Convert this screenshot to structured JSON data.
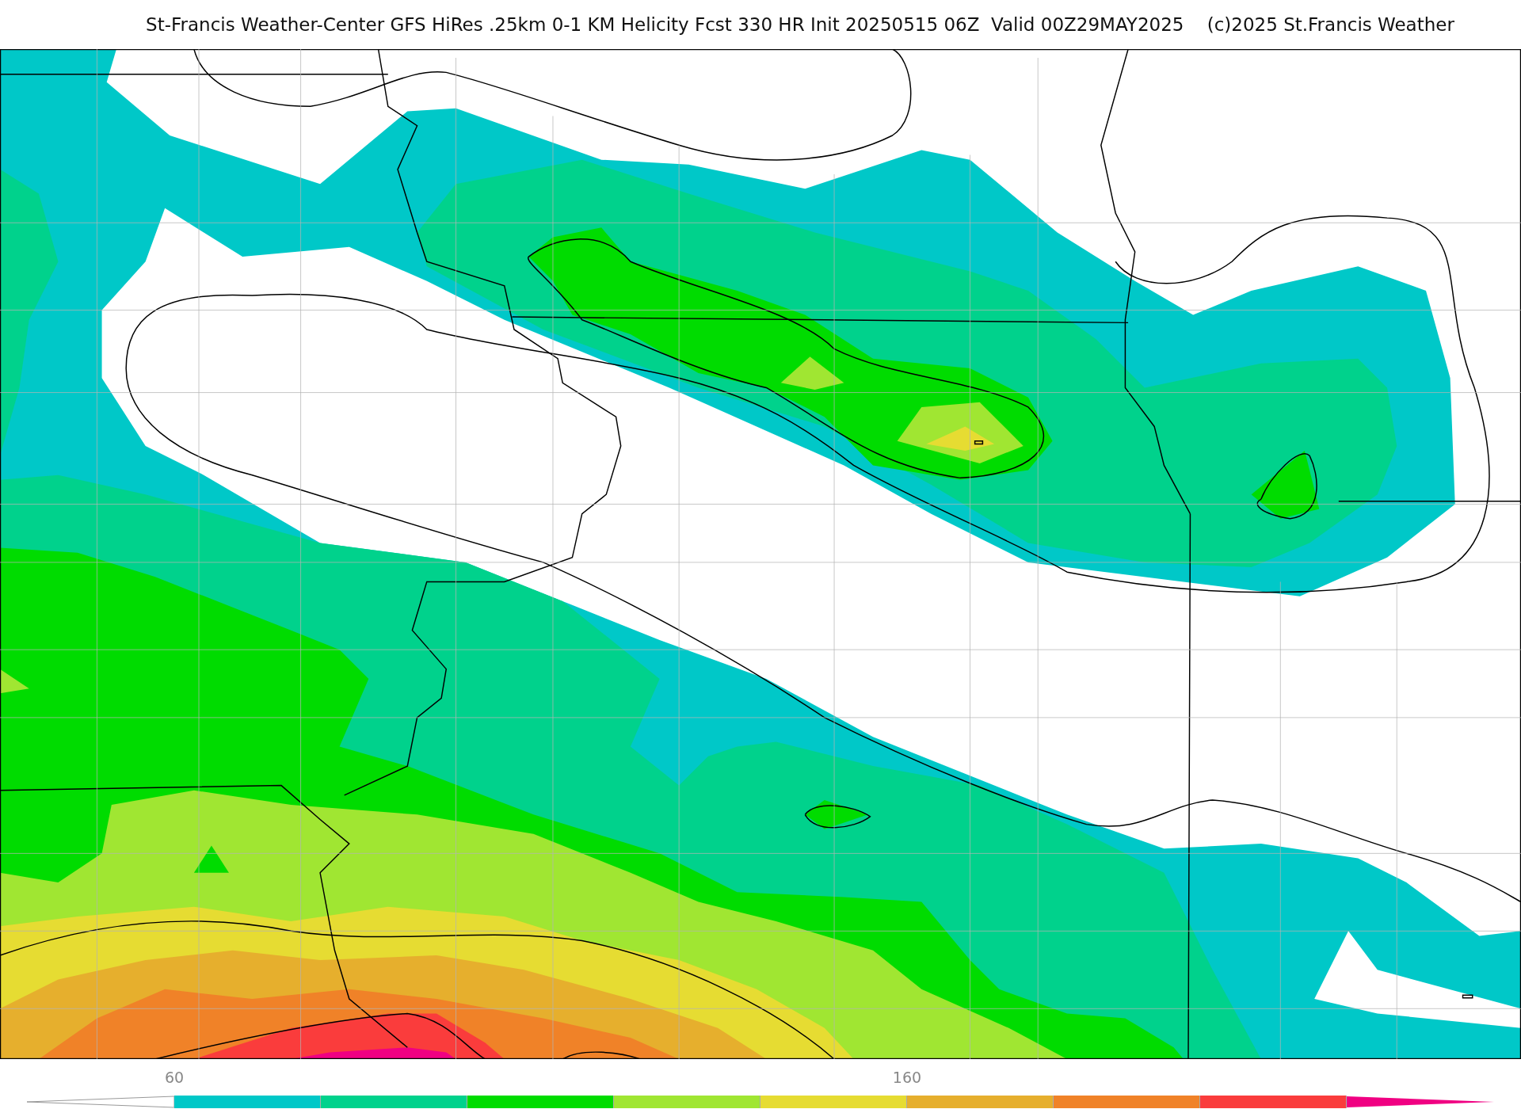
{
  "title": "St-Francis Weather-Center GFS HiRes .25km 0-1 KM Helicity Fcst 330 HR Init 20250515 06Z  Valid 00Z29MAY2025    (c)2025 St.Francis Weather",
  "colorbar": {
    "segments": [
      {
        "kind": "box",
        "color": "#00c8c8"
      },
      {
        "kind": "box",
        "color": "#00d28c"
      },
      {
        "kind": "box",
        "color": "#00dc00"
      },
      {
        "kind": "box",
        "color": "#a0e632"
      },
      {
        "kind": "box",
        "color": "#e6dc32"
      },
      {
        "kind": "box",
        "color": "#e6af2d"
      },
      {
        "kind": "box",
        "color": "#f08228"
      },
      {
        "kind": "box",
        "color": "#fa3c3c"
      },
      {
        "kind": "arrow",
        "color": "#f00082"
      }
    ],
    "ticks": [
      {
        "label": "60"
      },
      {
        "label": "160"
      }
    ]
  }
}
